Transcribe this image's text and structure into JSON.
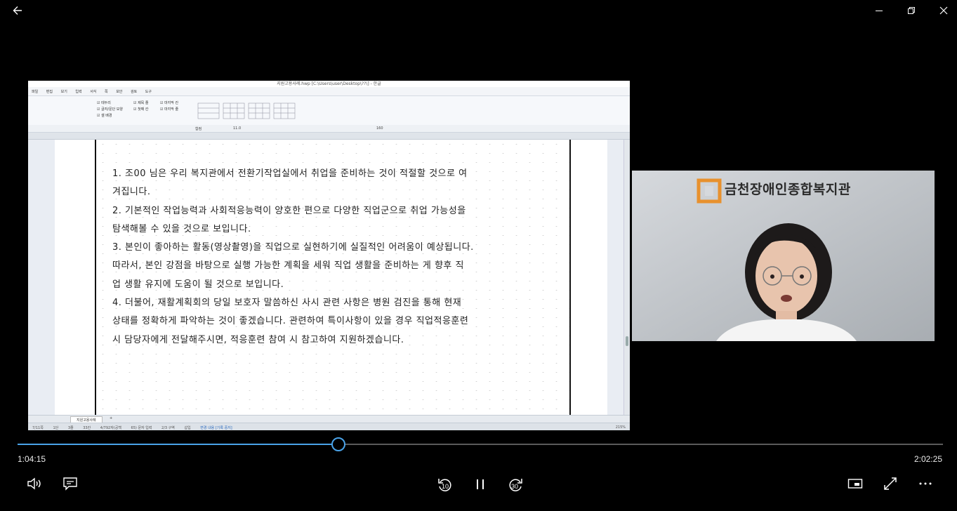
{
  "window": {
    "back_icon": "arrow-left-icon",
    "minimize_icon": "minimize-icon",
    "restore_icon": "restore-icon",
    "close_icon": "close-icon"
  },
  "document": {
    "title": "지원고용사례.hwp [C:\\Users\\user\\Desktop\\??\\] - 한글",
    "menu": [
      "파일",
      "편집",
      "보기",
      "입력",
      "서식",
      "쪽",
      "보안",
      "검토",
      "도구"
    ],
    "ribbon_checkboxes": [
      "테두리",
      "글자/문단 모양",
      "셀 배경",
      "제목 줄",
      "첫째 칸",
      "마지막 칸",
      "마지막 줄"
    ],
    "font_name": "함컴",
    "font_size": "11.0",
    "zoom_percent": "160",
    "paragraphs": [
      "1. 조00 님은 우리 복지관에서 전환기작업실에서 취업을 준비하는 것이 적절할 것으로 여",
      "겨집니다.",
      "2. 기본적인 작업능력과 사회적응능력이 양호한 편으로 다양한 직업군으로 취업 가능성을",
      "탐색해볼 수 있을 것으로 보입니다.",
      "3. 본인이 좋아하는 활동(영상촬영)을 직업으로 실현하기에 실질적인 어려움이 예상됩니다.",
      "따라서, 본인 강점을 바탕으로 실행 가능한 계획을 세워 직업 생활을 준비하는 게 향후 직",
      "업 생활 유지에 도움이 될 것으로 보입니다.",
      "4. 더불어, 재활계획회의 당일 보호자 말씀하신 사시 관련 사항은 병원 검진을 통해 현재",
      "상태를 정확하게 파악하는 것이 좋겠습니다. 관련하여 특이사항이 있을 경우 직업적응훈련",
      "시 담당자에게 전달해주시면, 적응훈련 참여 시 참고하여 지원하겠습니다."
    ],
    "sheet_tab": "지원고용사례",
    "status": [
      "7/11쪽",
      "1단",
      "3줄",
      "33칸",
      "4/792자(공백",
      "65) 문자 입력",
      "2/3 구역",
      "삽입",
      "변경 내용 [기록 중지]",
      "215%"
    ]
  },
  "webcam": {
    "sign_text": "금천장애인종합복지관",
    "accent_color": "#e8912e"
  },
  "player": {
    "current_time": "1:04:15",
    "total_time": "2:02:25",
    "progress_fraction": 0.347,
    "skip_back_seconds": "10",
    "skip_forward_seconds": "30",
    "accent_color": "#4aa3e8"
  }
}
